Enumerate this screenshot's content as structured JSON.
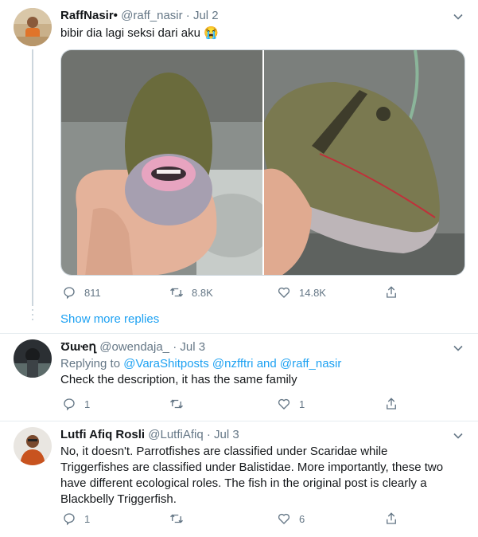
{
  "tweet1": {
    "name": "RaffNasir•",
    "handle": "@raff_nasir",
    "date": "Jul 2",
    "text": "bibir dia lagi seksi dari aku 😭",
    "reply_count": "811",
    "retweet_count": "8.8K",
    "like_count": "14.8K"
  },
  "show_more": "Show more replies",
  "tweet2": {
    "name": "Ʊɯҽղ",
    "handle": "@owendaja_",
    "date": "Jul 3",
    "replying_prefix": "Replying to",
    "mention1": "@VaraShitposts",
    "mention2": "@nzfftri",
    "and": "and",
    "mention3": "@raff_nasir",
    "text": "Check the description, it has the same family",
    "reply_count": "1",
    "like_count": "1"
  },
  "tweet3": {
    "name": "Lutfi Afiq Rosli",
    "handle": "@LutfiAfiq",
    "date": "Jul 3",
    "text_lines": [
      "No, it doesn't. Parrotfishes are classified under Scaridae while",
      "Triggerfishes are classified under Balistidae. More importantly, these two",
      "have different ecological roles. The fish in the original post is clearly a",
      "Blackbelly Triggerfish."
    ],
    "reply_count": "1",
    "like_count": "6"
  },
  "icons": [
    "chevron-down-icon",
    "reply-icon",
    "retweet-icon",
    "like-icon",
    "share-icon"
  ],
  "colors": {
    "accent": "#1da1f2",
    "secondary_text": "#657786",
    "border": "#e6ecf0"
  }
}
